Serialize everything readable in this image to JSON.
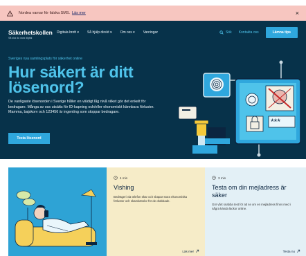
{
  "alert": {
    "text": "Nordea varnar för falska SMS.",
    "link": "Läs mer"
  },
  "brand": {
    "name": "Säkerhetskollen",
    "tagline": "Så ska du vara digital"
  },
  "nav": {
    "items": [
      "Digitala brott ▾",
      "Så hjälp direkt ▾",
      "Om oss ▾",
      "Varningar"
    ],
    "search": "Sök",
    "contact": "Kontakta oss",
    "tip_button": "Lämna tips"
  },
  "hero": {
    "kicker": "Sveriges nya samlingsplats för säkerhet online",
    "title_line1": "Hur säkert är ditt",
    "title_line2": "lösenord?",
    "lead": "De vanligaste lösenorden i Sverige håller en väldigt låg nivå vilket gör det enkelt för bedragare. Många av oss utsätts för ID-kapning och/eller ekonomiskt kännbara förluster. Mamma, bajskorv och 123456 är ingenting som stoppar bedragare.",
    "cta": "Testa lösenord"
  },
  "cards": [
    {
      "read_time": "4 min",
      "title": "Vishing",
      "desc": "Bedrägeri via telefon ökar och skapar stora ekonomiska förluster och skamkänslor för de drabbade.",
      "more": "Läs mer"
    },
    {
      "read_time": "3 min",
      "title": "Testa om din mejladress är säker",
      "desc": "Gör vårt snabba test för att se om en mejladress finns med i några kända läckor online.",
      "more": "Testa nu"
    }
  ],
  "colors": {
    "hero_bg": "#07324a",
    "accent": "#4fc3ea",
    "button": "#2fa7dd",
    "alert_bg": "#f7c6c0",
    "card_yellow": "#f6ecc8",
    "card_blue": "#e3f0f6",
    "card_image_bg": "#2ea3d5"
  },
  "icons": [
    "warning-icon",
    "close-icon",
    "search-icon",
    "clock-icon",
    "arrow-icon"
  ]
}
